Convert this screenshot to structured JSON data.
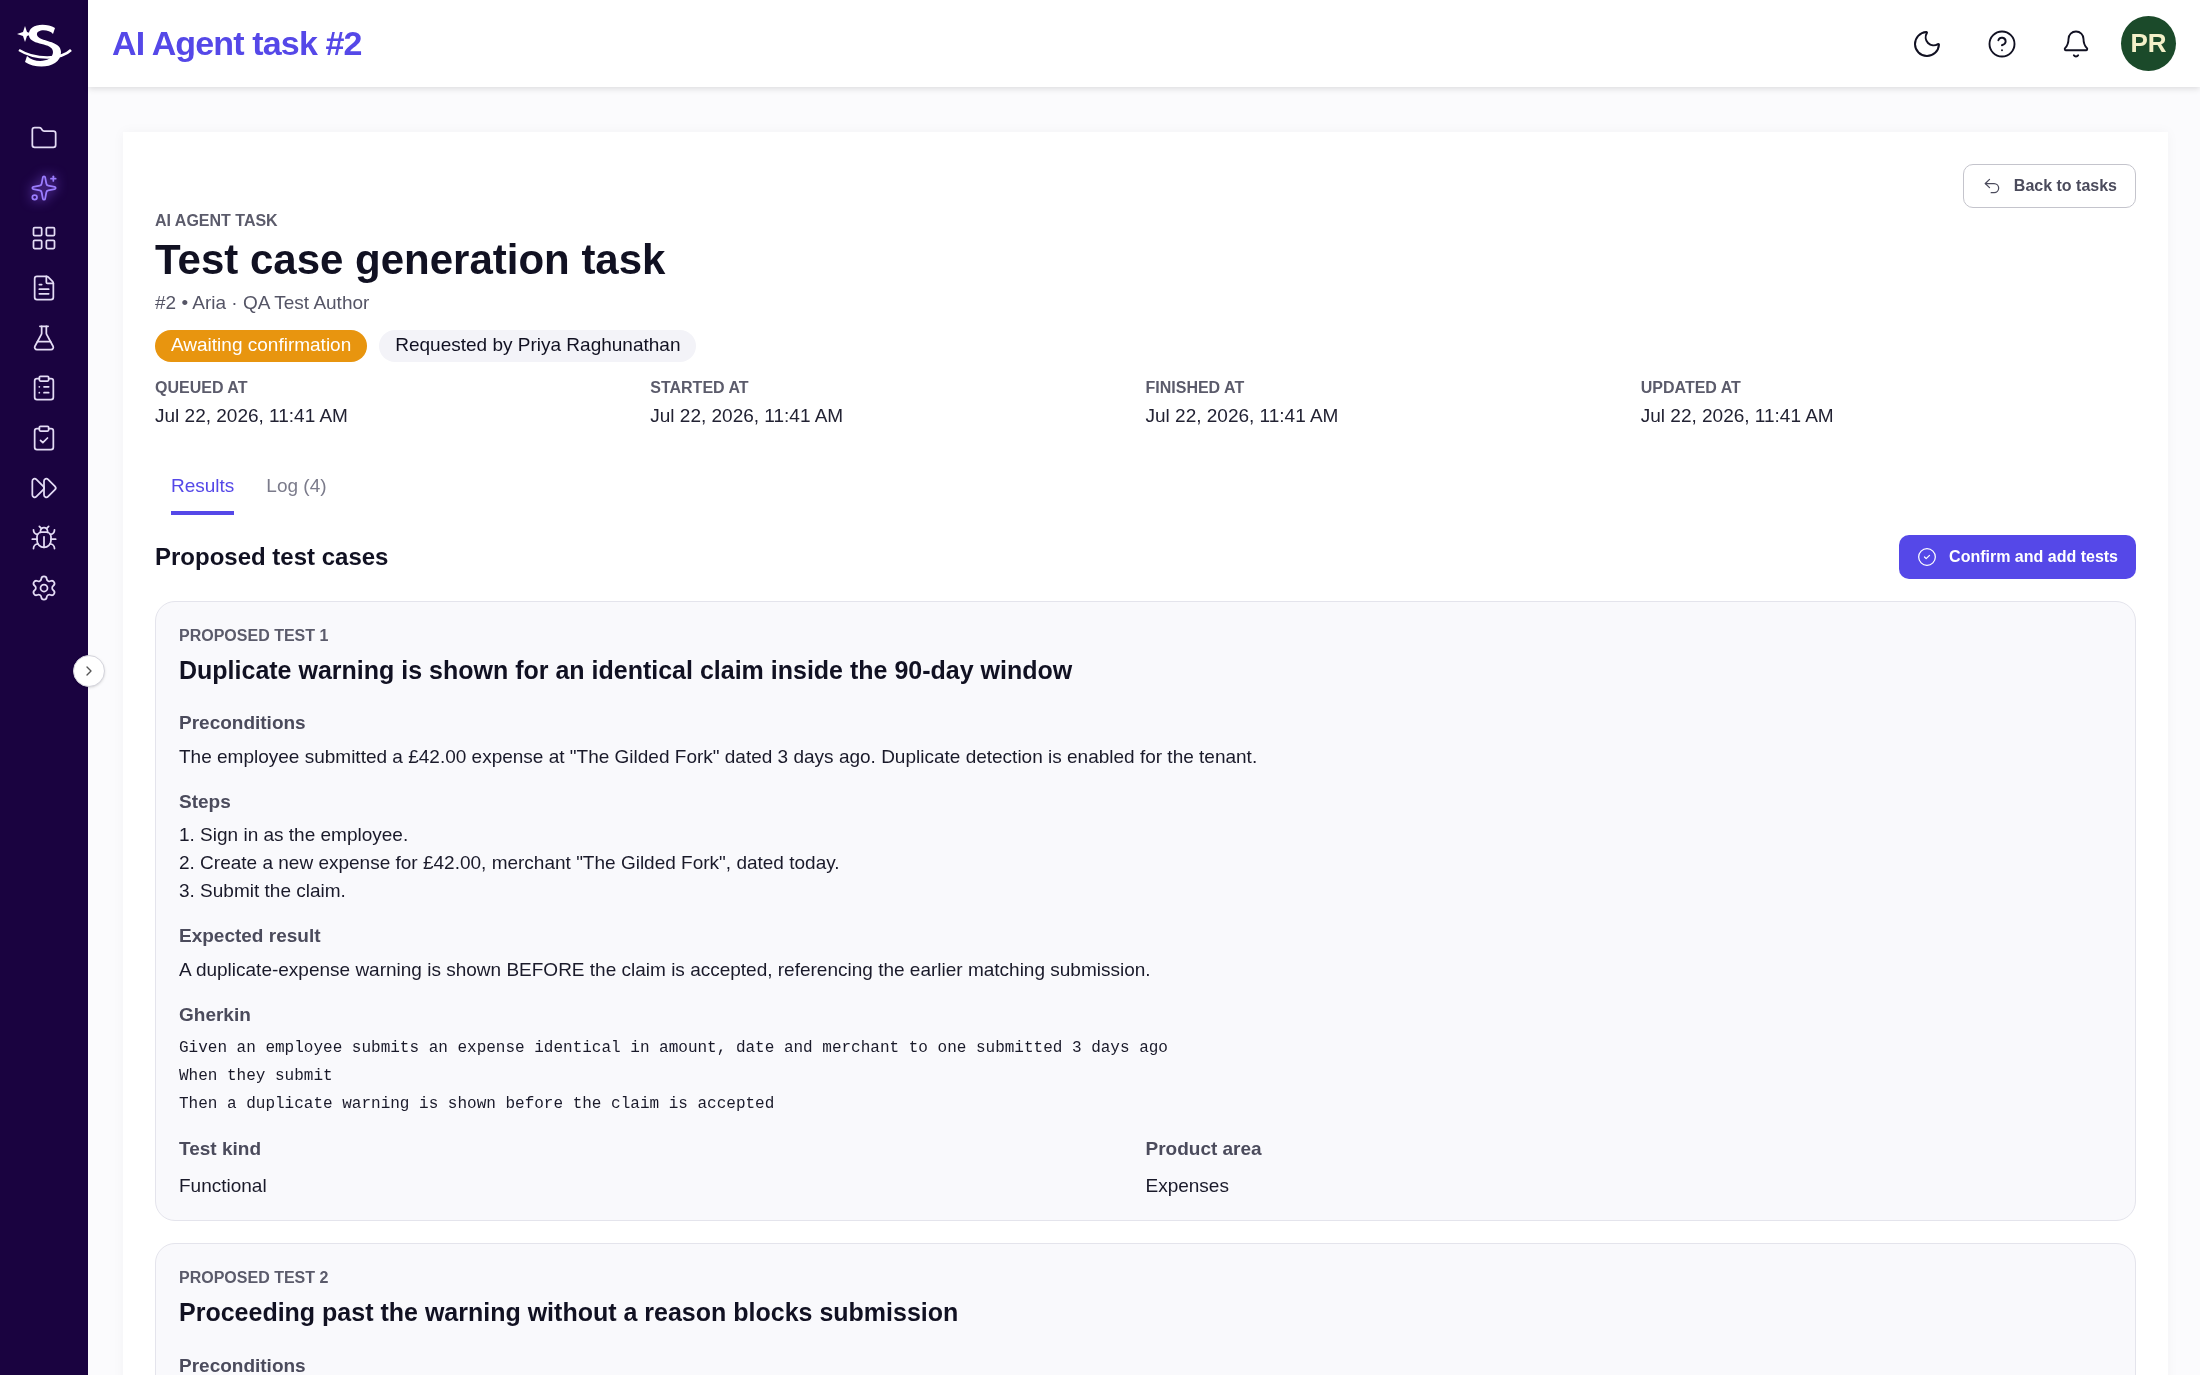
{
  "header": {
    "title": "AI Agent task #2",
    "avatar": "PR"
  },
  "sidebar": {
    "items": [
      {
        "kind": "folder",
        "selected": false
      },
      {
        "kind": "sparkles",
        "selected": true
      },
      {
        "kind": "grid",
        "selected": false
      },
      {
        "kind": "file",
        "selected": false
      },
      {
        "kind": "flask",
        "selected": false
      },
      {
        "kind": "clipboard-list",
        "selected": false
      },
      {
        "kind": "clipboard-check",
        "selected": false
      },
      {
        "kind": "fast-forward",
        "selected": false
      },
      {
        "kind": "bug",
        "selected": false
      },
      {
        "kind": "settings",
        "selected": false
      }
    ]
  },
  "task": {
    "eyebrow": "AI AGENT TASK",
    "title": "Test case generation task",
    "subtitle": "#2 • Aria · QA Test Author",
    "back_button": "Back to tasks",
    "badges": [
      {
        "kind": "status",
        "label": "Awaiting confirmation"
      },
      {
        "kind": "plain",
        "label": "Requested by Priya Raghunathan"
      }
    ],
    "timestamps": [
      {
        "label": "QUEUED AT",
        "value": "Jul 22, 2026, 11:41 AM"
      },
      {
        "label": "STARTED AT",
        "value": "Jul 22, 2026, 11:41 AM"
      },
      {
        "label": "FINISHED AT",
        "value": "Jul 22, 2026, 11:41 AM"
      },
      {
        "label": "UPDATED AT",
        "value": "Jul 22, 2026, 11:41 AM"
      }
    ]
  },
  "tabs": [
    {
      "label": "Results",
      "selected": true
    },
    {
      "label": "Log (4)",
      "selected": false
    }
  ],
  "results": {
    "heading": "Proposed test cases",
    "confirm_button": "Confirm and add tests",
    "tests": [
      {
        "eyebrow": "PROPOSED TEST 1",
        "title": "Duplicate warning is shown for an identical claim inside the 90-day window",
        "sections": [
          {
            "kind": "text",
            "label": "Preconditions",
            "lines": [
              "The employee submitted a £42.00 expense at \"The Gilded Fork\" dated 3 days ago. Duplicate detection is enabled for the tenant."
            ]
          },
          {
            "kind": "text",
            "label": "Steps",
            "lines": [
              "1. Sign in as the employee.",
              "2. Create a new expense for £42.00, merchant \"The Gilded Fork\", dated today.",
              "3. Submit the claim."
            ]
          },
          {
            "kind": "text",
            "label": "Expected result",
            "lines": [
              "A duplicate-expense warning is shown BEFORE the claim is accepted, referencing the earlier matching submission."
            ]
          },
          {
            "kind": "code",
            "label": "Gherkin",
            "lines": [
              "Given an employee submits an expense identical in amount, date and merchant to one submitted 3 days ago",
              "When they submit",
              "Then a duplicate warning is shown before the claim is accepted"
            ]
          }
        ],
        "fields": [
          {
            "label": "Test kind",
            "value": "Functional"
          },
          {
            "label": "Product area",
            "value": "Expenses"
          }
        ]
      },
      {
        "eyebrow": "PROPOSED TEST 2",
        "title": "Proceeding past the warning without a reason blocks submission",
        "sections": [
          {
            "kind": "text",
            "label": "Preconditions"
          }
        ]
      }
    ]
  }
}
